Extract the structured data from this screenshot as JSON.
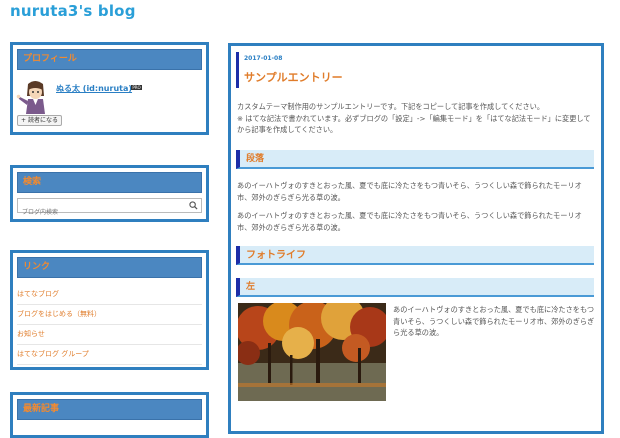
{
  "blog": {
    "title": "nuruta3's blog"
  },
  "sidebar": {
    "profile": {
      "heading": "プロフィール",
      "name": "ぬる太 (id:nuruta)",
      "badge": "PRO",
      "reader_button": "読者になる"
    },
    "search": {
      "heading": "検索",
      "placeholder": "ブログ内検索"
    },
    "links": {
      "heading": "リンク",
      "items": [
        "はてなブログ",
        "ブログをはじめる（無料）",
        "お知らせ",
        "はてなブログ グループ"
      ]
    },
    "recent": {
      "heading": "最新記事"
    }
  },
  "entry": {
    "date": "2017-01-08",
    "title": "サンプルエントリー",
    "intro": "カスタムテーマ制作用のサンプルエントリーです。下記をコピーして記事を作成してください。\n※ はてな記法で書かれています。必ずブログの「設定」->「編集モード」を「はてな記法モード」に変更してから記事を作成してください。",
    "section_heading": "段落",
    "paragraph1": "あのイーハトヴォのすきとおった風、夏でも底に冷たさをもつ青いそら、うつくしい森で飾られたモーリオ市、郊外のぎらぎら光る草の波。",
    "paragraph2": "あのイーハトヴォのすきとおった風、夏でも底に冷たさをもつ青いそら、うつくしい森で飾られたモーリオ市、郊外のぎらぎら光る草の波。",
    "photolife_heading": "フォトライフ",
    "left_heading": "左",
    "paragraph3": "あのイーハトヴォのすきとおった風、夏でも底に冷たさをもつ青いそら、うつくしい森で飾られたモーリオ市、郊外のぎらぎら光る草の波。"
  },
  "colors": {
    "accent": "#2a9fd8",
    "module_border": "#2f7fbf",
    "heading_orange": "#e07c2a",
    "heading_bar": "#1d2ea8"
  }
}
